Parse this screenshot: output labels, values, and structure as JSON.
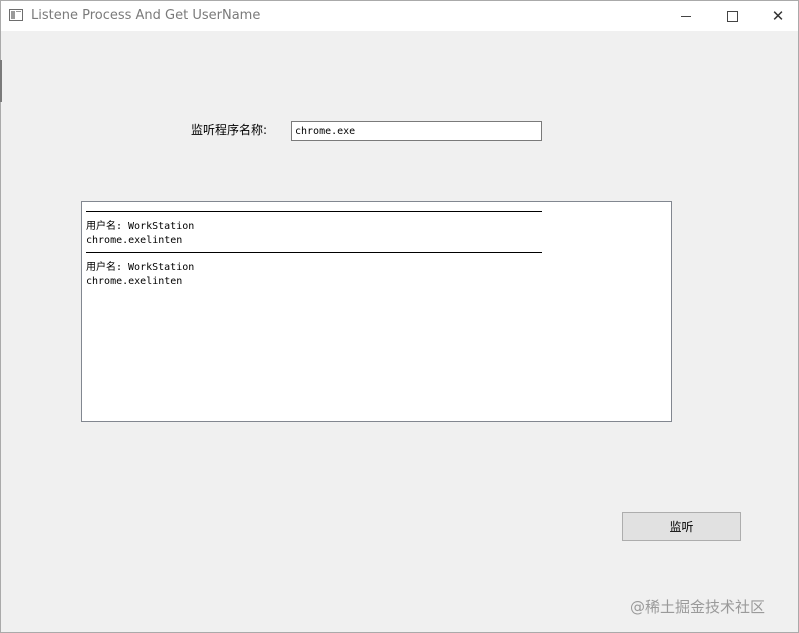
{
  "window": {
    "title": "Listene Process And Get UserName",
    "minimize_glyph": "—",
    "maximize_glyph": "☐",
    "close_glyph": "✕"
  },
  "form": {
    "process_label": "监听程序名称:",
    "process_value": "chrome.exe"
  },
  "output": {
    "records": [
      {
        "user_line": "用户名: WorkStation",
        "detail_line": "chrome.exelinten"
      },
      {
        "user_line": "用户名: WorkStation",
        "detail_line": "chrome.exelinten"
      }
    ]
  },
  "actions": {
    "listen_label": "监听"
  },
  "watermark": "@稀土掘金技术社区",
  "icons": [
    "app-icon",
    "minimize-icon",
    "maximize-icon",
    "close-icon"
  ]
}
